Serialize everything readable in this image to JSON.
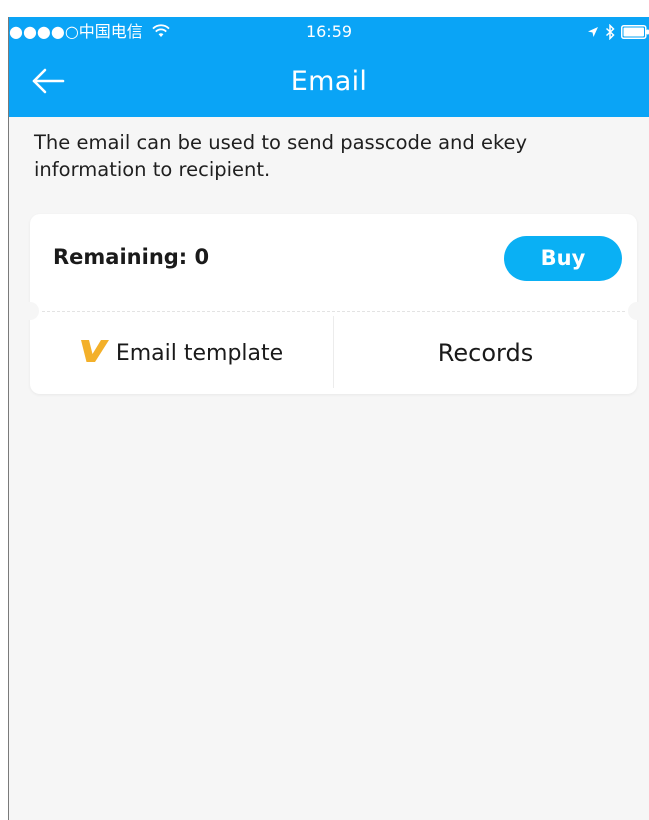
{
  "status_bar": {
    "carrier": "●●●●○中国电信",
    "time": "16:59"
  },
  "nav": {
    "title": "Email"
  },
  "description": "The email can be used to send passcode and ekey information to recipient.",
  "card": {
    "remaining_label": "Remaining: 0",
    "buy_label": "Buy",
    "template_label": "Email template",
    "records_label": "Records"
  },
  "colors": {
    "primary": "#0aa4f6",
    "buy_button": "#0ab0f4",
    "vip_icon": "#f3b02a",
    "background": "#f6f6f6"
  },
  "icons": [
    "signal-dots-icon",
    "wifi-icon",
    "location-arrow-icon",
    "bluetooth-icon",
    "battery-icon",
    "back-arrow-icon",
    "vip-v-icon"
  ]
}
